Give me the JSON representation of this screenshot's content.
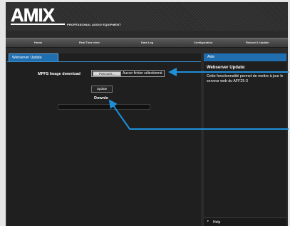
{
  "header": {
    "logo_text": "AMIX",
    "tagline": "PROFESSIONAL AUDIO EQUIPMENT"
  },
  "nav": {
    "items": [
      {
        "label": "Home"
      },
      {
        "label": "Real Time view"
      },
      {
        "label": "Data Log"
      },
      {
        "label": "Configuration"
      },
      {
        "label": "Reboot & Update"
      }
    ]
  },
  "main": {
    "tab_label": "Webserver Update",
    "mpfs_label": "MPFS Image download",
    "browse_label": "Parcourir...",
    "no_file_text": "Aucun fichier sélectionné.",
    "update_label": "Update",
    "download_label": "Downlo",
    "progress": 0
  },
  "aide": {
    "header": "Aide",
    "title": "Webserver Update:",
    "text": "Cette fonctionnalité permet de mettre à jour le serveur web du AFF25-3",
    "help_label": "Help"
  },
  "colors": {
    "accent": "#1f6fb0",
    "annotation_arrow": "#1e90d8",
    "panel": "#1f1f1f",
    "page": "#2b2b2b"
  },
  "icons": {
    "help_arrow": "triangle-right-icon"
  }
}
